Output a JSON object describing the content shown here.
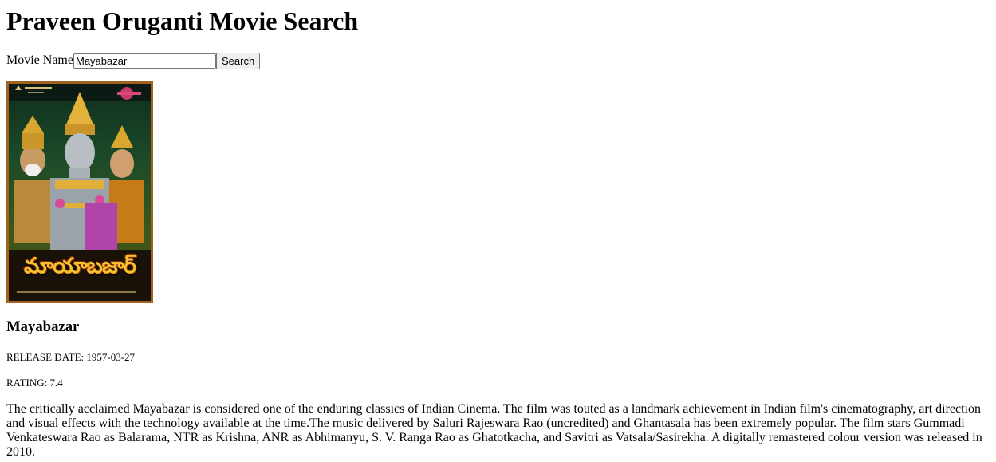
{
  "page": {
    "title": "Praveen Oruganti Movie Search"
  },
  "search": {
    "label": "Movie Name",
    "value": "Mayabazar",
    "button_label": "Search"
  },
  "movie": {
    "poster_title_art": "మాయాబజార్",
    "title": "Mayabazar",
    "release_label": "RELEASE DATE:",
    "release_date": "1957-03-27",
    "rating_label": "RATING:",
    "rating": "7.4",
    "overview": "The critically acclaimed Mayabazar is considered one of the enduring classics of Indian Cinema. The film was touted as a landmark achievement in Indian film's cinematography, art direction and visual effects with the technology available at the time.The music delivered by Saluri Rajeswara Rao (uncredited) and Ghantasala has been extremely popular. The film stars Gummadi Venkateswara Rao as Balarama, NTR as Krishna, ANR as Abhimanyu, S. V. Ranga Rao as Ghatotkacha, and Savitri as Vatsala/Sasirekha. A digitally remastered colour version was released in 2010."
  },
  "colors": {
    "poster_frame": "#a0621c",
    "poster_title_art": "#f2c230"
  }
}
